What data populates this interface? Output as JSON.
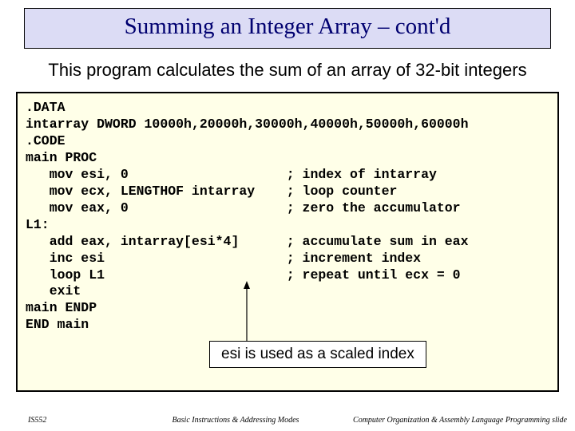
{
  "title": "Summing an Integer Array – cont'd",
  "subtitle": "This program calculates the sum of an array of 32-bit integers",
  "code": ".DATA\nintarray DWORD 10000h,20000h,30000h,40000h,50000h,60000h\n.CODE\nmain PROC\n   mov esi, 0                    ; index of intarray\n   mov ecx, LENGTHOF intarray    ; loop counter\n   mov eax, 0                    ; zero the accumulator\nL1:\n   add eax, intarray[esi*4]      ; accumulate sum in eax\n   inc esi                       ; increment index\n   loop L1                       ; repeat until ecx = 0\n   exit\nmain ENDP\nEND main",
  "callout": "esi is used as a scaled index",
  "footer": {
    "left": "IS552",
    "center": "Basic Instructions & Addressing Modes",
    "right": "Computer Organization & Assembly Language Programming slide"
  }
}
